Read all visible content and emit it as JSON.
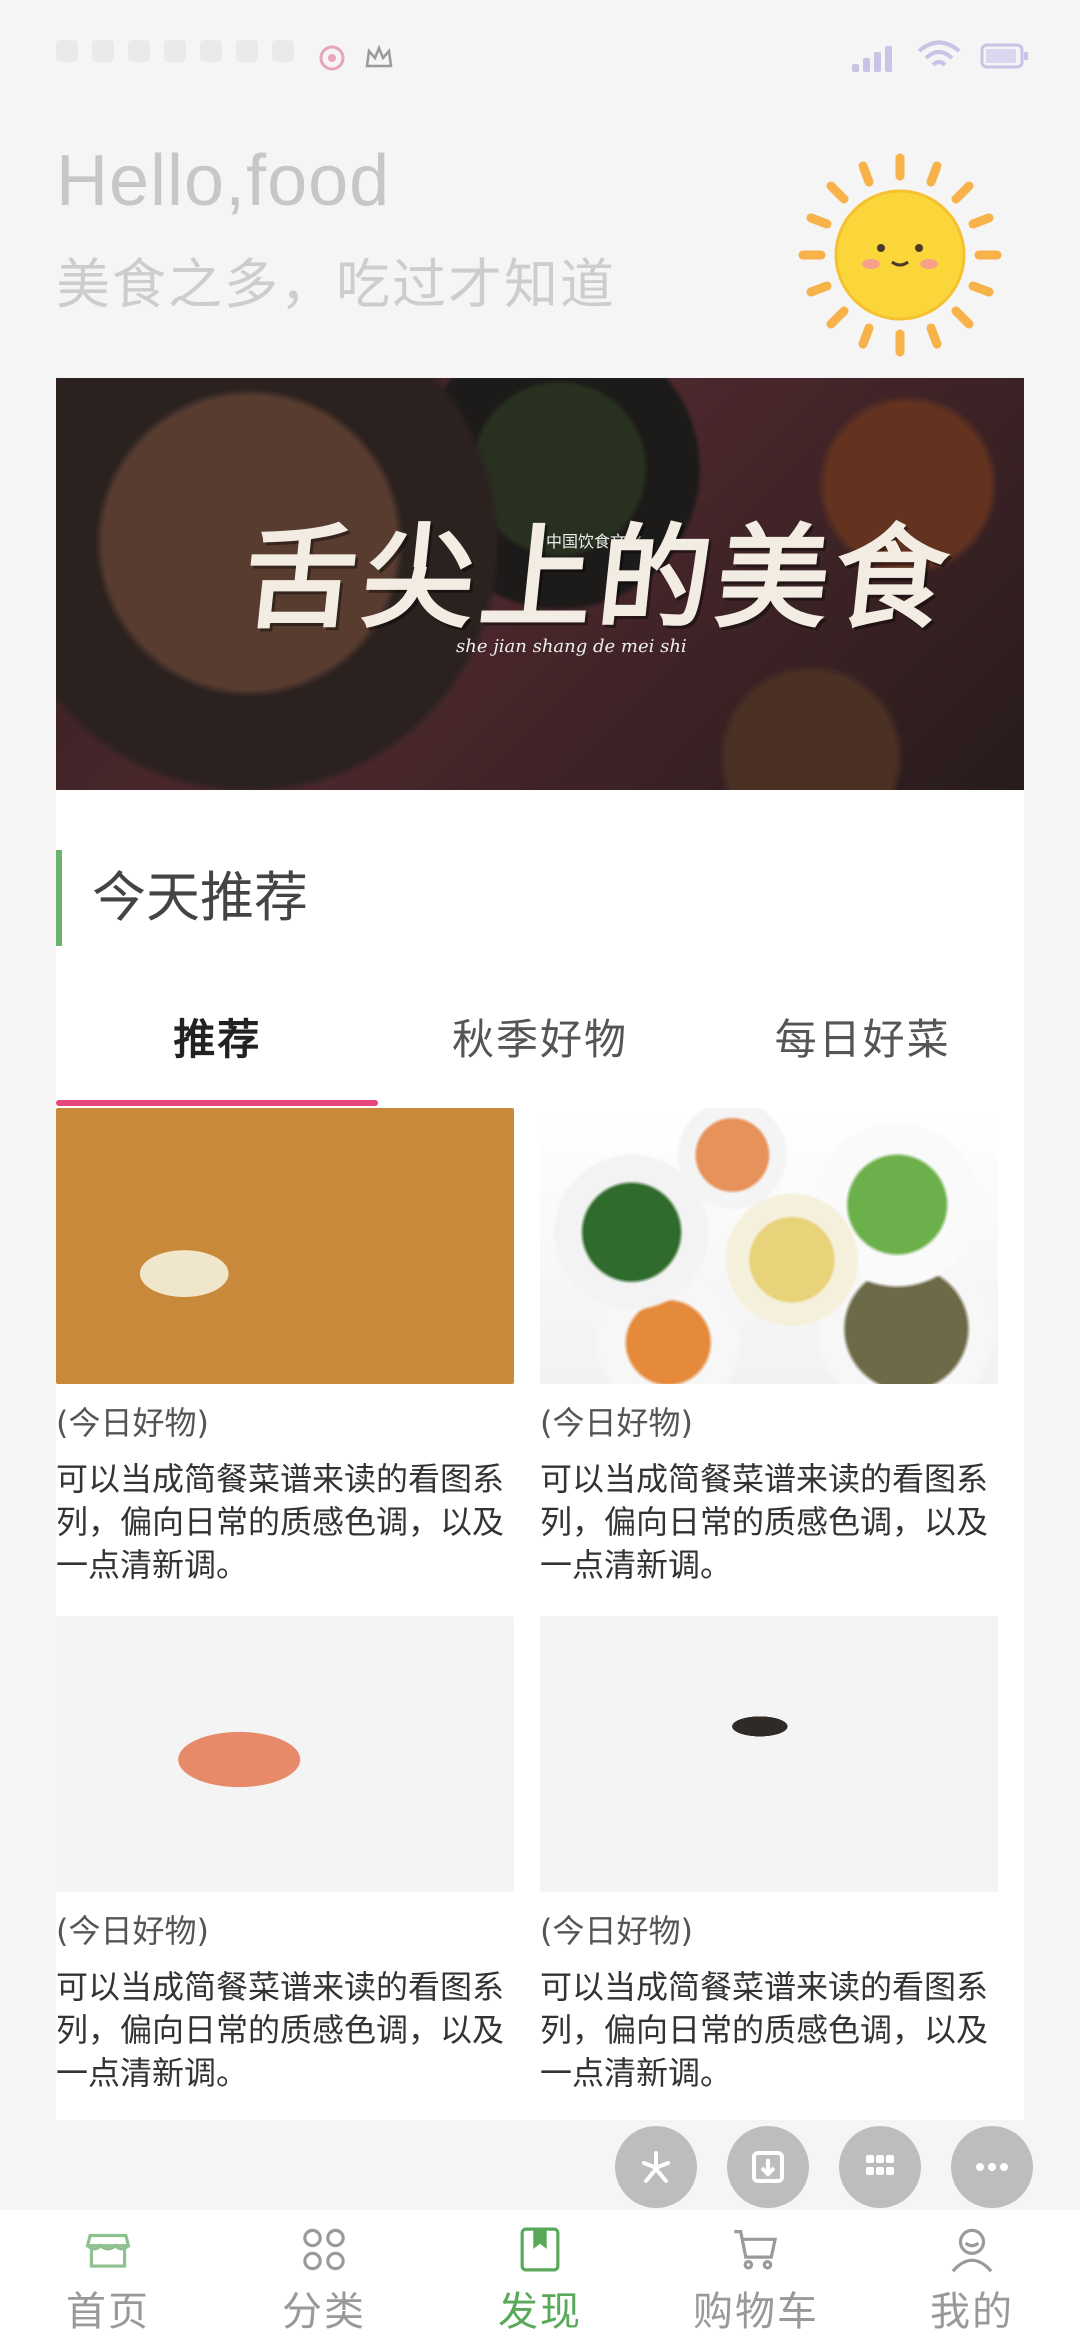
{
  "header": {
    "greeting": "Hello,food",
    "slogan": "美食之多，吃过才知道"
  },
  "banner": {
    "title": "舌尖上的美食",
    "pinyin": "she jian shang de mei shi",
    "subtitle": "中国饮食文化"
  },
  "section": {
    "title": "今天推荐"
  },
  "tabs": [
    {
      "label": "推荐",
      "active": true
    },
    {
      "label": "秋季好物",
      "active": false
    },
    {
      "label": "每日好菜",
      "active": false
    }
  ],
  "cards": [
    {
      "tag": "(今日好物)",
      "desc": "可以当成简餐菜谱来读的看图系列，偏向日常的质感色调，以及一点清新调。"
    },
    {
      "tag": "(今日好物)",
      "desc": "可以当成简餐菜谱来读的看图系列，偏向日常的质感色调，以及一点清新调。"
    },
    {
      "tag": "(今日好物)",
      "desc": "可以当成简餐菜谱来读的看图系列，偏向日常的质感色调，以及一点清新调。"
    },
    {
      "tag": "(今日好物)",
      "desc": "可以当成简餐菜谱来读的看图系列，偏向日常的质感色调，以及一点清新调。"
    }
  ],
  "floating_toolbar": [
    {
      "icon": "sparkle-icon"
    },
    {
      "icon": "download-icon"
    },
    {
      "icon": "grid-icon"
    },
    {
      "icon": "more-icon"
    }
  ],
  "bottom_nav": [
    {
      "label": "首页",
      "icon": "store-icon",
      "active": false
    },
    {
      "label": "分类",
      "icon": "category-icon",
      "active": false
    },
    {
      "label": "发现",
      "icon": "bookmark-icon",
      "active": true
    },
    {
      "label": "购物车",
      "icon": "cart-icon",
      "active": false
    },
    {
      "label": "我的",
      "icon": "user-icon",
      "active": false
    }
  ],
  "colors": {
    "accent_green": "#5aa85a",
    "tab_indicator": "#e6447d",
    "inactive_gray": "#999999"
  }
}
